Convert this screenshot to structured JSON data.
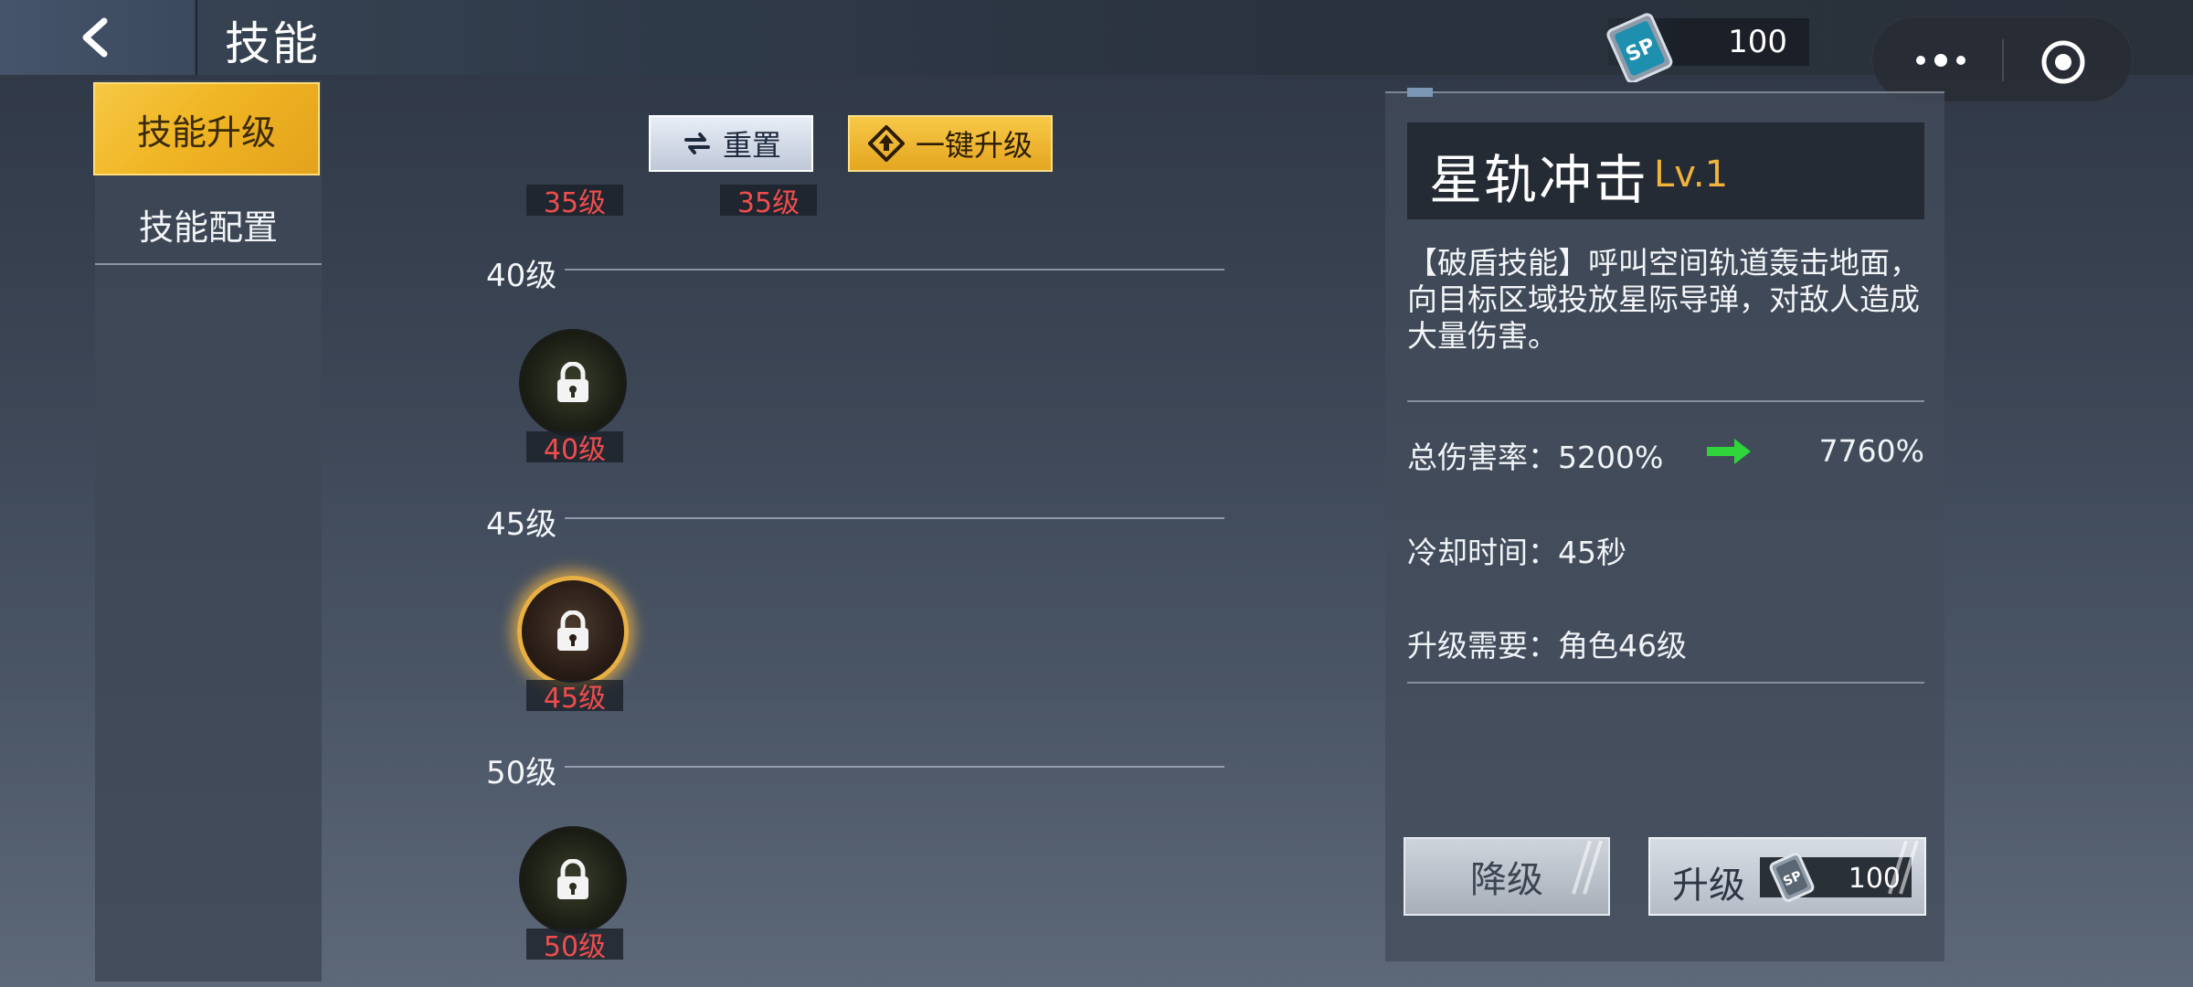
{
  "header": {
    "title": "技能",
    "back_icon": "chevron-left-icon",
    "currency": {
      "icon": "sp-card-icon",
      "icon_text": "SP",
      "value": "100"
    },
    "capsule": {
      "more_icon": "more-dots-icon",
      "close_icon": "target-circle-icon"
    }
  },
  "sidebar": {
    "tabs": [
      {
        "label": "技能升级",
        "active": true
      },
      {
        "label": "技能配置",
        "active": false
      }
    ]
  },
  "toolbar": {
    "reset_label": "重置",
    "reset_icon": "refresh-icon",
    "oneclick_label": "一键升级",
    "oneclick_icon": "upgrade-diamond-icon"
  },
  "tree": {
    "top_tags": [
      "35级",
      "35级"
    ],
    "rows": [
      {
        "label": "40级",
        "node_tag": "40级",
        "locked": true,
        "selected": false
      },
      {
        "label": "45级",
        "node_tag": "45级",
        "locked": true,
        "selected": true
      },
      {
        "label": "50级",
        "node_tag": "50级",
        "locked": true,
        "selected": false
      }
    ]
  },
  "detail": {
    "name": "星轨冲击",
    "level": "Lv.1",
    "description": "【破盾技能】呼叫空间轨道轰击地面，向目标区域投放星际导弹，对敌人造成大量伤害。",
    "damage_label": "总伤害率：5200%",
    "damage_next": "7760%",
    "cooldown": "冷却时间：45秒",
    "requirement": "升级需要：角色46级",
    "downgrade_label": "降级",
    "upgrade_label": "升级",
    "upgrade_cost": "100",
    "accent_color": "#f0b43c",
    "arrow_color": "#2fd43a"
  }
}
